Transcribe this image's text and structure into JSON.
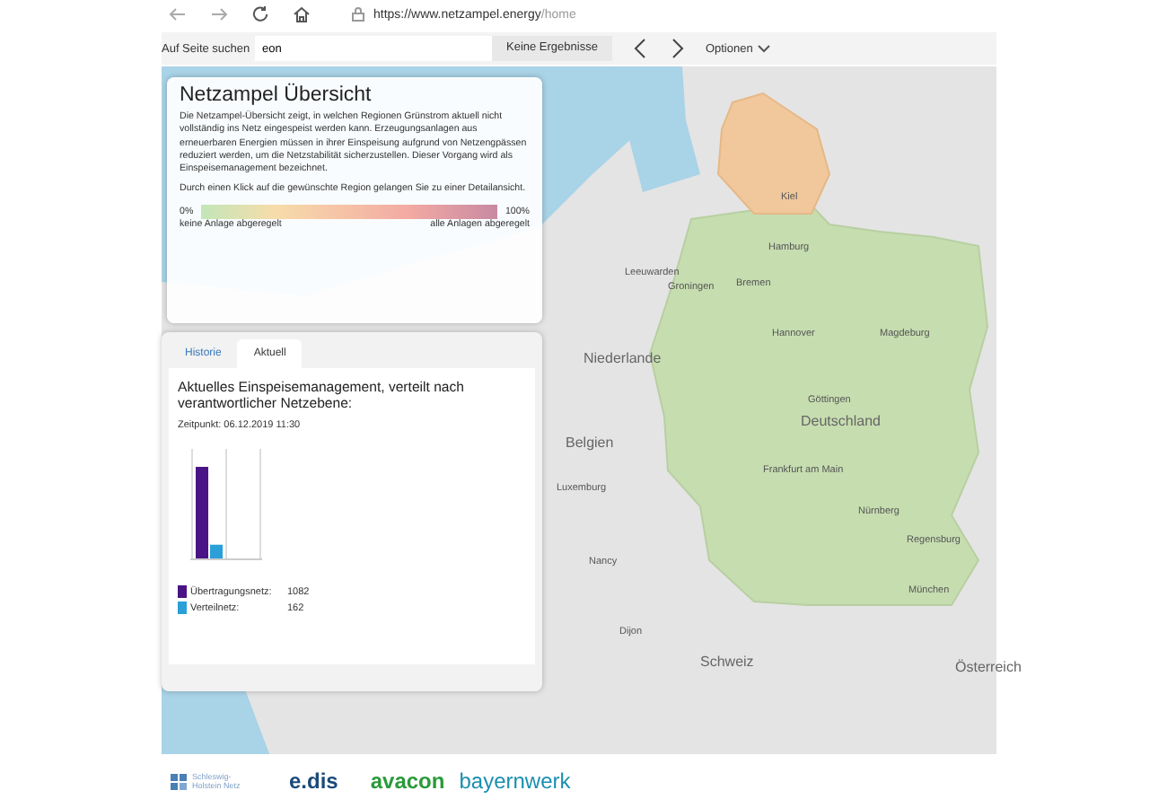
{
  "browser": {
    "url_host": "https://www.netzampel.energy",
    "url_path": "/home"
  },
  "find_bar": {
    "label": "Auf Seite suchen",
    "value": "eon",
    "result": "Keine Ergebnisse",
    "options": "Optionen"
  },
  "overview": {
    "title": "Netzampel Übersicht",
    "text": "Die Netzampel-Übersicht zeigt, in welchen Regionen Grünstrom aktuell nicht vollständig ins Netz eingespeist werden kann. Erzeugungsanlagen aus erneuerbaren Energien müssen in ihrer Einspeisung aufgrund von Netzengpässen reduziert werden, um die Netzstabilität sicherzustellen. Dieser Vorgang wird als Einspeisemanagement bezeichnet.",
    "hint": "Durch einen Klick auf die gewünschte Region gelangen Sie zu einer Detailansicht.",
    "scale_min": "0%",
    "scale_max": "100%",
    "scale_min_label": "keine Anlage abgeregelt",
    "scale_max_label": "alle Anlagen abgeregelt"
  },
  "tabs": [
    {
      "label": "Historie",
      "selected": false
    },
    {
      "label": "Aktuell",
      "selected": true
    }
  ],
  "current": {
    "heading": "Aktuelles Einspeisemanagement, verteilt nach verantwortlicher Netzebene:",
    "timestamp": "Zeitpunkt: 06.12.2019 11:30",
    "legend": [
      {
        "label": "Übertragungsnetz:",
        "value": "1082",
        "color": "#4a1486"
      },
      {
        "label": "Verteilnetz:",
        "value": "162",
        "color": "#2a9fd8"
      }
    ]
  },
  "map_labels": [
    "Kiel",
    "Hamburg",
    "Bremen",
    "Hannover",
    "Magdeburg",
    "Leeuwarden",
    "Groningen",
    "Niederlande",
    "Göttingen",
    "Deutschland",
    "Belgien",
    "Luxemburg",
    "Frankfurt am Main",
    "Nürnberg",
    "Regensburg",
    "München",
    "Nancy",
    "Dijon",
    "Schweiz",
    "Österreich"
  ],
  "footer_logos": [
    {
      "kind": "shnetz",
      "text": "Schleswig-Holstein Netz"
    },
    {
      "kind": "edis",
      "text": "e.dis"
    },
    {
      "kind": "avacon",
      "text": "avacon"
    },
    {
      "kind": "bayernwerk",
      "text": "bayernwerk"
    }
  ]
}
